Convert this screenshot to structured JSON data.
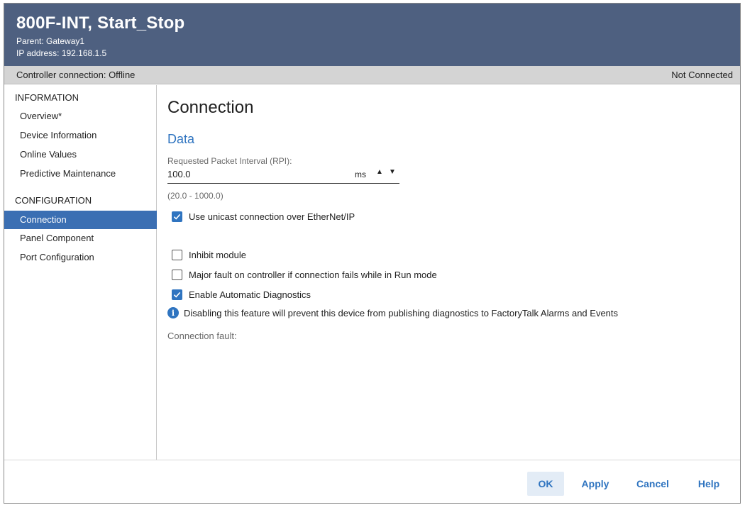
{
  "header": {
    "title": "800F-INT, Start_Stop",
    "parent": "Parent: Gateway1",
    "ip": "IP address: 192.168.1.5"
  },
  "status": {
    "left": "Controller connection: Offline",
    "right": "Not Connected"
  },
  "sidebar": {
    "info_heading": "INFORMATION",
    "info_items": [
      "Overview*",
      "Device Information",
      "Online Values",
      "Predictive Maintenance"
    ],
    "config_heading": "CONFIGURATION",
    "config_items": [
      "Connection",
      "Panel Component",
      "Port Configuration"
    ]
  },
  "main": {
    "title": "Connection",
    "section": "Data",
    "rpi_label": "Requested Packet Interval (RPI):",
    "rpi_value": "100.0",
    "rpi_unit": "ms",
    "rpi_range": "(20.0 - 1000.0)",
    "unicast": {
      "label": "Use unicast connection over EtherNet/IP",
      "checked": true
    },
    "inhibit": {
      "label": "Inhibit module",
      "checked": false
    },
    "major_fault": {
      "label": "Major fault on controller if connection fails while in Run mode",
      "checked": false
    },
    "diagnostics": {
      "label": "Enable Automatic Diagnostics",
      "checked": true
    },
    "info_text": "Disabling this feature will prevent this device from publishing diagnostics to FactoryTalk Alarms and Events",
    "fault_label": "Connection fault:"
  },
  "footer": {
    "ok": "OK",
    "apply": "Apply",
    "cancel": "Cancel",
    "help": "Help"
  },
  "icons": {
    "spin_up": "▲",
    "spin_down": "▼",
    "info": "i"
  },
  "colors": {
    "header_bg": "#4e6080",
    "accent": "#2f74c0",
    "selected_nav": "#3b6fb3"
  }
}
